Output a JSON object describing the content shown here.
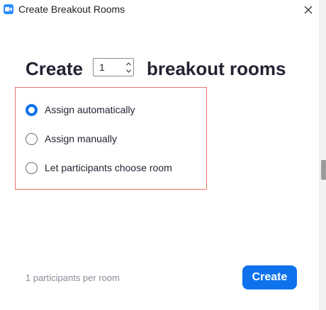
{
  "window": {
    "title": "Create Breakout Rooms"
  },
  "header": {
    "prefix": "Create",
    "room_count": "1",
    "suffix": "breakout rooms"
  },
  "options": [
    {
      "label": "Assign automatically",
      "selected": true
    },
    {
      "label": "Assign manually",
      "selected": false
    },
    {
      "label": "Let participants choose room",
      "selected": false
    }
  ],
  "footer": {
    "note": "1 participants per room",
    "create_label": "Create"
  },
  "colors": {
    "accent": "#0e72ed",
    "highlight_border": "#e8726a",
    "muted_text": "#8c8c9a"
  },
  "icons": {
    "app": "zoom-camera-icon",
    "close": "close-icon",
    "stepper_up": "chevron-up-icon",
    "stepper_down": "chevron-down-icon"
  }
}
